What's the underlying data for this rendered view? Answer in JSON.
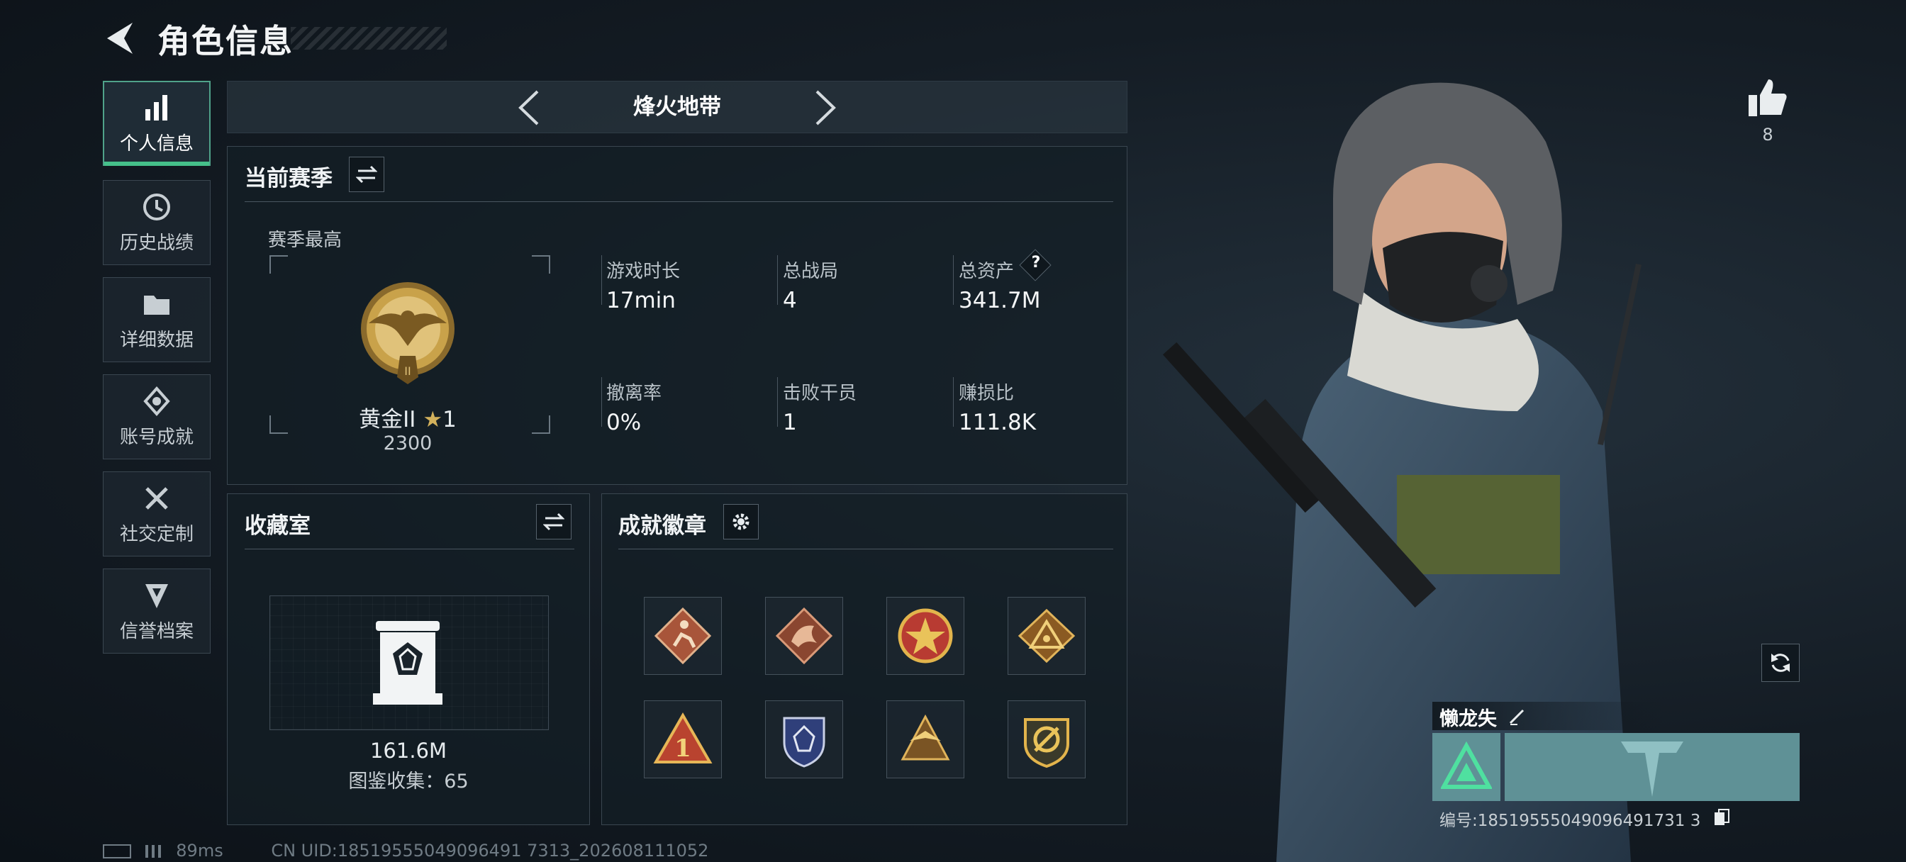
{
  "header": {
    "title": "角色信息"
  },
  "sidebar": {
    "items": [
      {
        "label": "个人信息",
        "icon": "bar-chart-icon",
        "active": true
      },
      {
        "label": "历史战绩",
        "icon": "history-clock-icon"
      },
      {
        "label": "详细数据",
        "icon": "folder-icon"
      },
      {
        "label": "账号成就",
        "icon": "medal-icon"
      },
      {
        "label": "社交定制",
        "icon": "tools-icon"
      },
      {
        "label": "信誉档案",
        "icon": "shield-badge-icon"
      }
    ]
  },
  "mode_selector": {
    "label": "烽火地带"
  },
  "season": {
    "title": "当前赛季",
    "best_label": "赛季最高",
    "rank_name": "黄金II",
    "rank_stars": "1",
    "rank_points": "2300",
    "stats": [
      {
        "label": "游戏时长",
        "value": "17min"
      },
      {
        "label": "总战局",
        "value": "4"
      },
      {
        "label": "总资产",
        "value": "341.7M",
        "help": "?"
      },
      {
        "label": "撤离率",
        "value": "0%"
      },
      {
        "label": "击败干员",
        "value": "1"
      },
      {
        "label": "赚损比",
        "value": "111.8K"
      }
    ]
  },
  "collection": {
    "title": "收藏室",
    "value": "161.6M",
    "count_text": "图鉴收集：65"
  },
  "badges": {
    "title": "成就徽章",
    "items": [
      "runner-badge-icon",
      "dragon-badge-icon",
      "star-seal-badge-icon",
      "triangle-eye-badge-icon",
      "number-one-badge-icon",
      "blue-crest-badge-icon",
      "winged-triangle-badge-icon",
      "gold-emblem-badge-icon"
    ]
  },
  "likes": {
    "count": "8"
  },
  "player": {
    "name": "懒龙失",
    "id_text": "编号:18519555049096491731 3"
  },
  "status": {
    "ping": "89ms",
    "uid": "CN UID:18519555049096491 7313_202608111052"
  },
  "colors": {
    "accent": "#45c08a",
    "panel_border": "#3a4650",
    "gold": "#c9a24a"
  }
}
